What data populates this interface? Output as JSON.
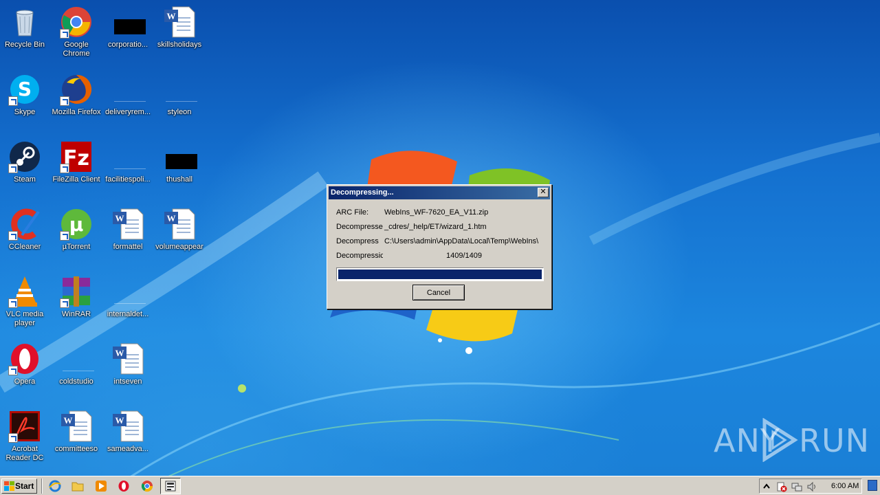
{
  "desktop": {
    "icons": [
      {
        "label": "Recycle Bin",
        "icon": "recycle-bin-icon"
      },
      {
        "label": "Google Chrome",
        "icon": "chrome-icon"
      },
      {
        "label": "corporatio...",
        "icon": "redacted-icon"
      },
      {
        "label": "skillsholidays",
        "icon": "word-document-icon"
      },
      {
        "label": "Skype",
        "icon": "skype-icon"
      },
      {
        "label": "Mozilla Firefox",
        "icon": "firefox-icon"
      },
      {
        "label": "deliveryrem...",
        "icon": "blank-file-icon"
      },
      {
        "label": "styleon",
        "icon": "blank-file-icon"
      },
      {
        "label": "Steam",
        "icon": "steam-icon"
      },
      {
        "label": "FileZilla Client",
        "icon": "filezilla-icon"
      },
      {
        "label": "facilitiespoli...",
        "icon": "blank-file-icon"
      },
      {
        "label": "thushall",
        "icon": "redacted-icon"
      },
      {
        "label": "CCleaner",
        "icon": "ccleaner-icon"
      },
      {
        "label": "µTorrent",
        "icon": "utorrent-icon"
      },
      {
        "label": "formattel",
        "icon": "word-document-icon"
      },
      {
        "label": "volumeappear",
        "icon": "word-document-icon"
      },
      {
        "label": "VLC media player",
        "icon": "vlc-icon"
      },
      {
        "label": "WinRAR",
        "icon": "winrar-icon"
      },
      {
        "label": "internaldet...",
        "icon": "blank-file-icon"
      },
      {
        "label": "Opera",
        "icon": "opera-icon"
      },
      {
        "label": "coldstudio",
        "icon": "blank-file-icon"
      },
      {
        "label": "intseven",
        "icon": "word-document-icon"
      },
      {
        "label": "Acrobat Reader DC",
        "icon": "acrobat-icon"
      },
      {
        "label": "committeeso",
        "icon": "word-document-icon"
      },
      {
        "label": "sameadva...",
        "icon": "word-document-icon"
      }
    ]
  },
  "dialog": {
    "title": "Decompressing...",
    "close_label": "✕",
    "rows": [
      {
        "key": "ARC File:",
        "value": "WebIns_WF-7620_EA_V11.zip"
      },
      {
        "key": "Decompresse",
        "value": "_cdres/_help/ET/wizard_1.htm"
      },
      {
        "key": "Decompress",
        "value": "C:\\Users\\admin\\AppData\\Local\\Temp\\WebIns\\"
      },
      {
        "key": "Decompressic",
        "value": "1409/1409"
      }
    ],
    "progress_fraction": 1.0,
    "cancel_label": "Cancel"
  },
  "watermark": {
    "left": "ANY",
    "right": "RUN"
  },
  "taskbar": {
    "start_label": "Start",
    "quicklaunch": [
      "internet-explorer-icon",
      "folder-icon",
      "media-player-icon",
      "opera-icon",
      "chrome-icon"
    ],
    "active_task_icon": "archive-app-icon",
    "tray_icons": [
      "show-hidden-arrow-icon",
      "security-alert-icon",
      "network-icon",
      "volume-icon"
    ],
    "clock": "6:00 AM"
  },
  "colors": {
    "dialog_bg": "#d4d0c8",
    "titlebar_start": "#0a246a",
    "titlebar_end": "#3a6ea5",
    "progress_fill": "#0a246a"
  }
}
